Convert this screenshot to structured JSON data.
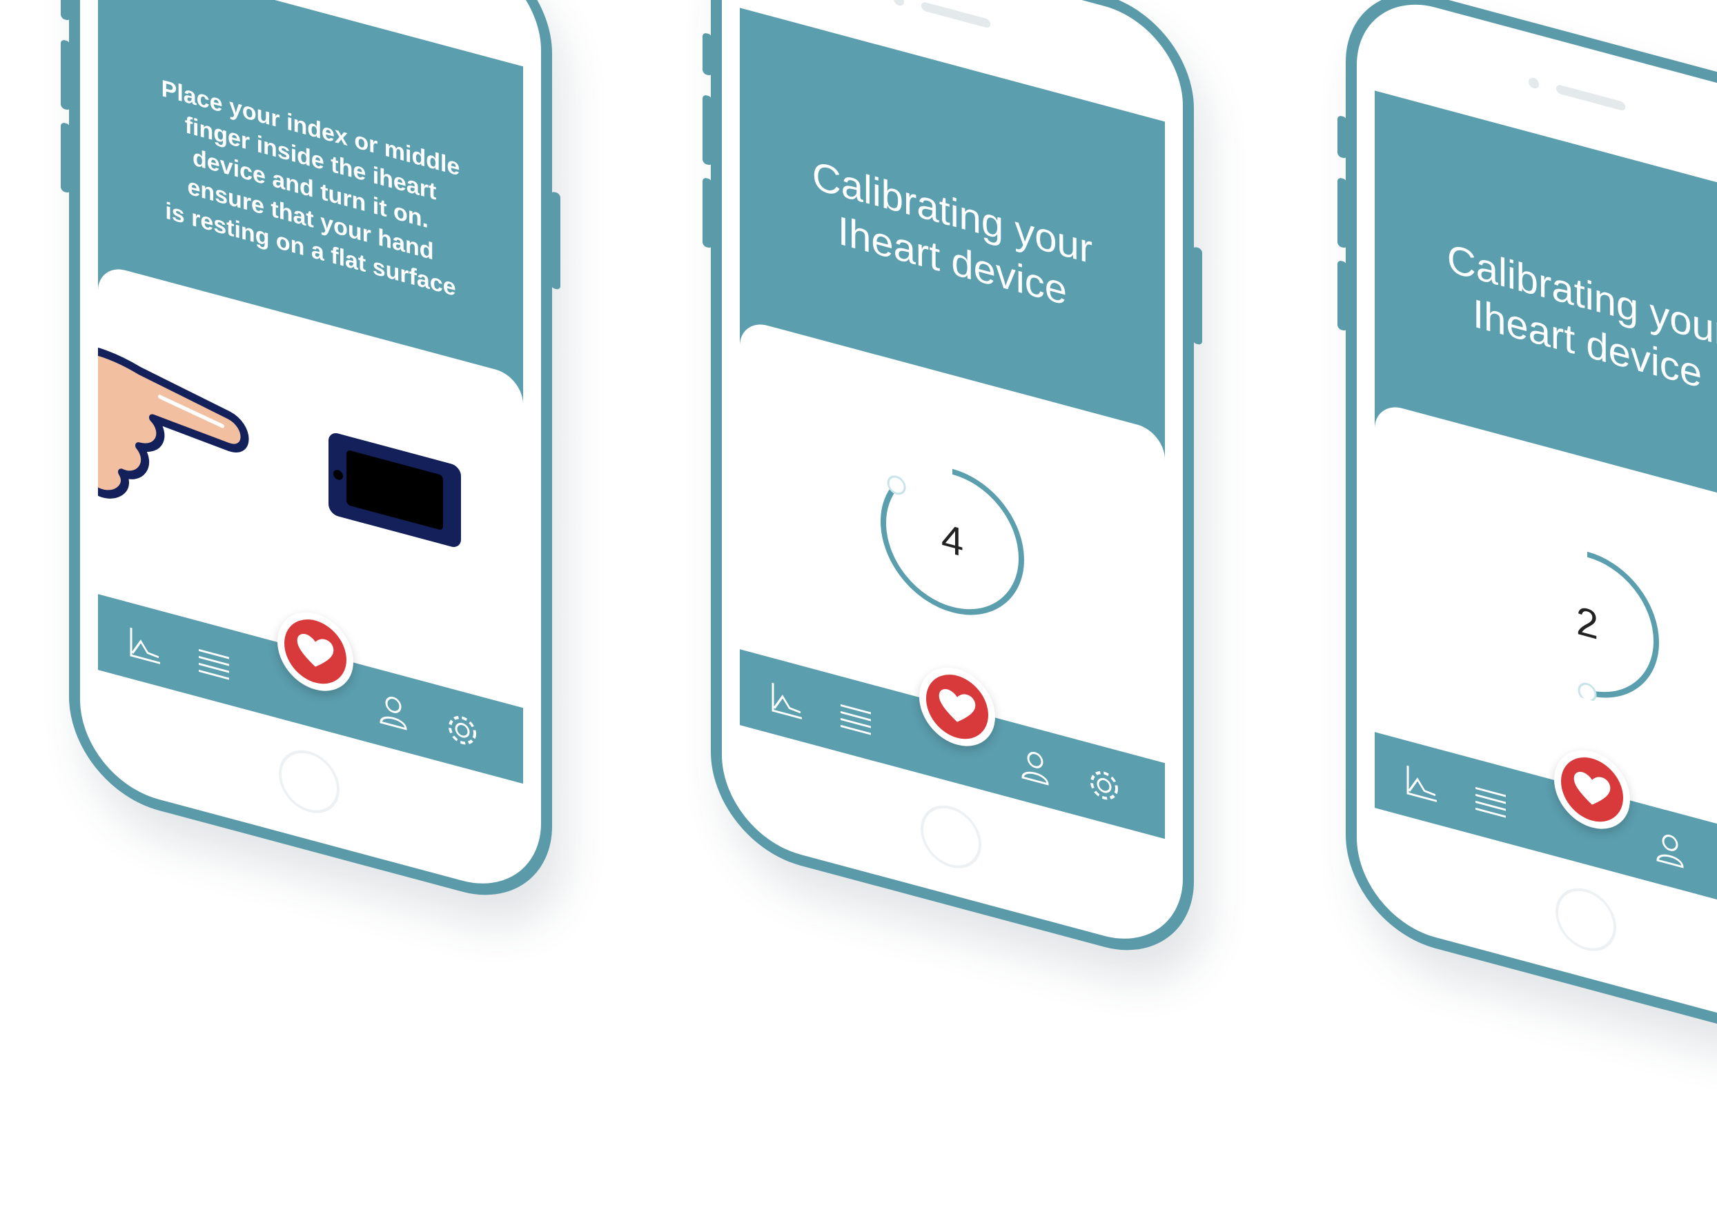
{
  "colors": {
    "primary": "#5b9eae",
    "phone_frame": "#5a9aa9",
    "heart_button": "#d8393a",
    "device_blue": "#13205a"
  },
  "screens": [
    {
      "id": "instruction",
      "instructions": "Place your index or middle\nfinger inside the iheart\ndevice and turn it on.\nensure that your hand\nis resting on a flat surface",
      "illustration": [
        "hand-pointing-icon",
        "iheart-device-icon"
      ]
    },
    {
      "id": "calibrating-4",
      "title": "Calibrating your\nIheart device",
      "countdown": "4",
      "progress": 0.85
    },
    {
      "id": "calibrating-2",
      "title": "Calibrating your\nIheart device",
      "countdown": "2",
      "progress": 0.5
    }
  ],
  "tabbar": {
    "icons": [
      "chart-icon",
      "list-icon",
      "heart-icon",
      "profile-icon",
      "settings-icon"
    ]
  }
}
